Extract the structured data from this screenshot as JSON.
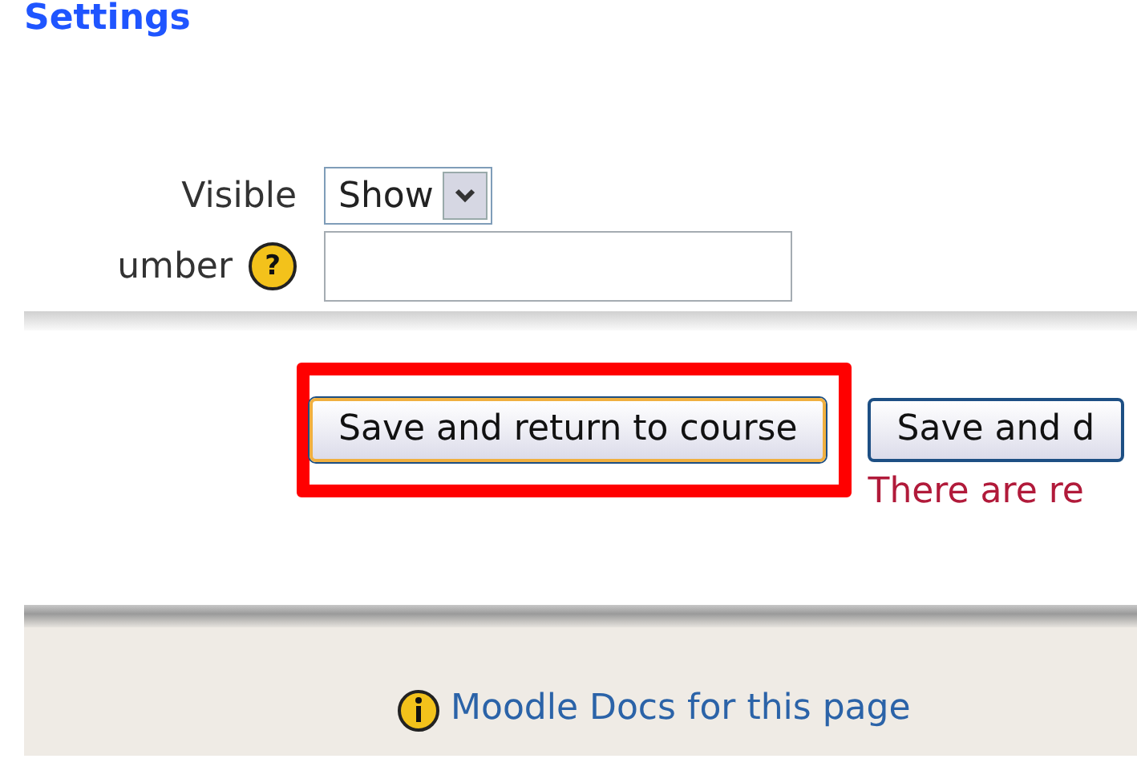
{
  "heading": "Settings",
  "fields": [
    {
      "kind": "select",
      "label": "Visible",
      "value": "Show"
    },
    {
      "kind": "text",
      "label": "umber",
      "help": "?"
    }
  ],
  "buttons": [
    {
      "label": "Save and return to course",
      "highlighted": true
    },
    {
      "label": "Save and d",
      "highlighted": false
    }
  ],
  "error": "There are re",
  "footer": {
    "link": "Moodle Docs for this page"
  }
}
